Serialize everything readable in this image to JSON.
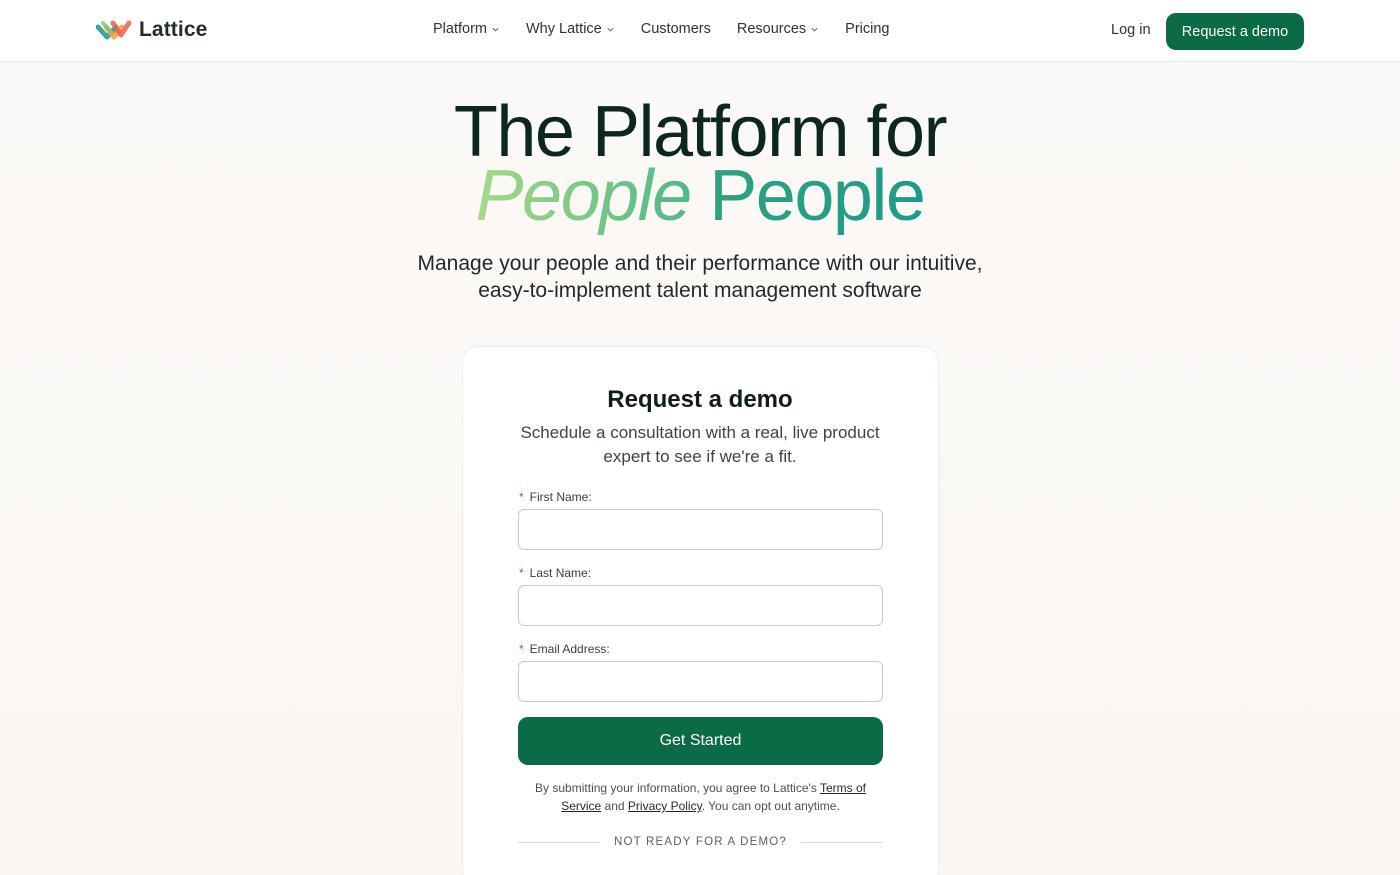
{
  "nav": {
    "logo_text": "Lattice",
    "links": [
      {
        "label": "Platform",
        "has_dropdown": true
      },
      {
        "label": "Why Lattice",
        "has_dropdown": true
      },
      {
        "label": "Customers",
        "has_dropdown": false
      },
      {
        "label": "Resources",
        "has_dropdown": true
      },
      {
        "label": "Pricing",
        "has_dropdown": false
      }
    ],
    "login_label": "Log in",
    "demo_button_label": "Request a demo"
  },
  "hero": {
    "title_line1": "The Platform for",
    "title_italic": "People",
    "title_gradient": "People",
    "subtitle": "Manage your people and their performance with our intuitive, easy-to-implement talent management software"
  },
  "form": {
    "title": "Request a demo",
    "subtitle": "Schedule a consultation with a real, live product expert to see if we're a fit.",
    "required_marker": "*",
    "first_name_label": "First Name:",
    "first_name_value": "",
    "last_name_label": "Last Name:",
    "last_name_value": "",
    "email_label": "Email Address:",
    "email_value": "",
    "submit_label": "Get Started",
    "legal_prefix": "By submitting your information, you agree to Lattice's ",
    "terms_label": "Terms of Service",
    "legal_and": " and ",
    "privacy_label": "Privacy Policy",
    "legal_suffix": ". You can opt out anytime.",
    "divider_text": "NOT READY FOR A DEMO?"
  },
  "colors": {
    "brand_green": "#0c6b47",
    "required_red": "#d4423a",
    "title_dark": "#0e2620"
  }
}
